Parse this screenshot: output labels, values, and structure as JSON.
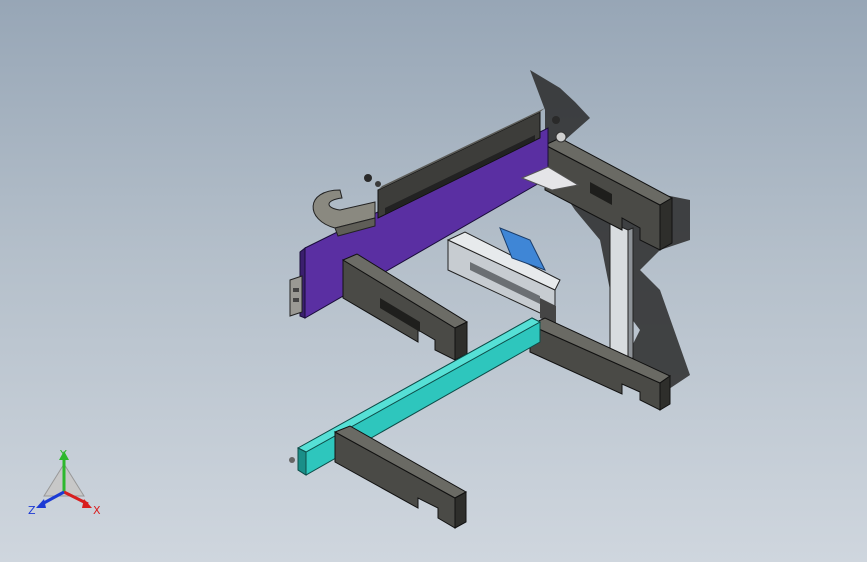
{
  "viewport": {
    "background_top": "#97a6b6",
    "background_bottom": "#cfd6de"
  },
  "triad": {
    "x_label": "X",
    "y_label": "Y",
    "z_label": "Z",
    "x_color": "#d81e1e",
    "y_color": "#2db82d",
    "z_color": "#1c3ad4"
  },
  "parts": {
    "purple_plate": "#5a2fa2",
    "teal_beam": "#2ec6bd",
    "dark_steel": "#4a4a46",
    "clamp_gray": "#7b7a72",
    "slide_silver": "#c7ccd1",
    "shadow": "#1f1f1f",
    "blue_motor": "#3f86d6"
  }
}
